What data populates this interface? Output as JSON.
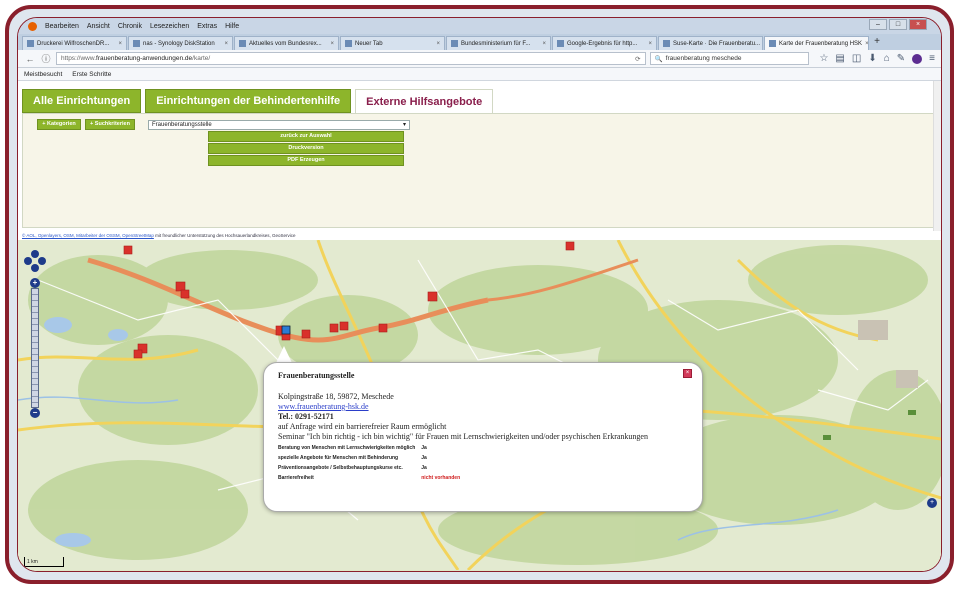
{
  "browser": {
    "menu": [
      "Bearbeiten",
      "Ansicht",
      "Chronik",
      "Lesezeichen",
      "Extras",
      "Hilfe"
    ],
    "tabs": [
      {
        "label": "Druckerei WilfroschenDR...",
        "active": false
      },
      {
        "label": "nas - Synology DiskStation",
        "active": false
      },
      {
        "label": "Aktuelles vom Bundesrex...",
        "active": false
      },
      {
        "label": "Neuer Tab",
        "active": false
      },
      {
        "label": "Bundesministerium für F...",
        "active": false
      },
      {
        "label": "Google-Ergebnis für http...",
        "active": false
      },
      {
        "label": "Suse-Karte · Die Frauenberatu...",
        "active": false
      },
      {
        "label": "Karte der Frauenberatung HSK",
        "active": true
      }
    ],
    "url": {
      "prefix": "https://www.",
      "domain": "frauenberatung-anwendungen.de",
      "suffix": "/karte/"
    },
    "search_value": "frauenberatung meschede",
    "bookmarks": [
      "Meistbesucht",
      "Erste Schritte"
    ]
  },
  "page": {
    "tabs": [
      {
        "label": "Alle Einrichtungen",
        "active": false
      },
      {
        "label": "Einrichtungen der Behindertenhilfe",
        "active": false
      },
      {
        "label": "Externe Hilfsangebote",
        "active": true
      }
    ],
    "buttons": {
      "kategorien": "+ Kategorien",
      "suchkriterien": "+ Suchkriterien",
      "zurueck": "zurück zur Auswahl",
      "druck": "Druckversion",
      "pdf": "PDF Erzeugen"
    },
    "select_value": "Frauenberatungsstelle",
    "attribution": {
      "links": "© AOL, Openlayers, OSM, Mitarbeiter der OSSM, OpenStreetMap",
      "rest": "mit freundlicher Unterstützung des Hochsauerlandkreises, GeoService"
    }
  },
  "popup": {
    "title": "Frauenberatungsstelle",
    "address": "Kolpingstraße 18, 59872, Meschede",
    "website": "www.frauenberatung-hsk.de",
    "phone": "Tel.: 0291-52171",
    "note1": "auf Anfrage wird ein barrierefreier Raum ermöglicht",
    "note2": "Seminar \"Ich bin richtig - ich bin wichtig\" für Frauen mit Lernschwierigkeiten und/oder psychischen Erkrankungen",
    "rows": [
      {
        "label": "Beratung von Menschen mit Lernschwierigkeiten möglich",
        "value": "Ja",
        "status": "ok"
      },
      {
        "label": "spezielle Angebote für Menschen mit Behinderung",
        "value": "Ja",
        "status": "ok"
      },
      {
        "label": "Präventionsangebote / Selbstbehauptungskurse etc.",
        "value": "Ja",
        "status": "ok"
      },
      {
        "label": "Barrierefreiheit",
        "value": "nicht vorhanden",
        "status": "missing"
      }
    ],
    "close_symbol": "×"
  },
  "map": {
    "scale_label": "1 km",
    "colors": {
      "marker": "#d9312b",
      "accent": "#8db52b",
      "popup_link": "#2b3ec9",
      "missing": "#d02020"
    }
  }
}
